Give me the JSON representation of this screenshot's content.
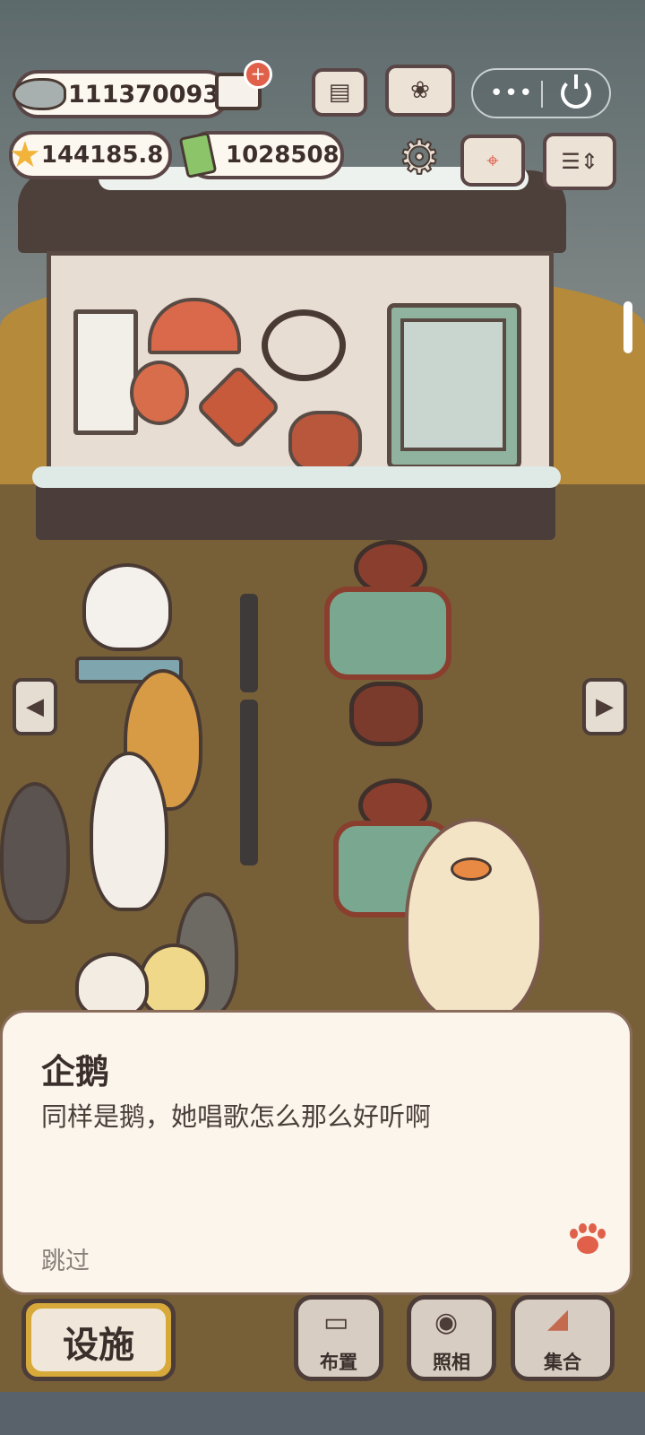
{
  "hud": {
    "fish_currency": "111370093",
    "star_currency": "144185.8",
    "ticket_currency": "1028508"
  },
  "dialog": {
    "speaker": "企鹅",
    "text": "同样是鹅，她唱歌怎么那么好听啊",
    "skip_label": "跳过"
  },
  "bottom_bar": {
    "facilities_label": "设施",
    "arrange_label": "布置",
    "photo_label": "照相",
    "gather_label": "集合"
  },
  "colors": {
    "accent": "#e0604a",
    "panel_bg": "#fbf5ec",
    "outline": "#5a4646",
    "facilities_gold": "#d7a93a"
  },
  "icons": [
    "fish-icon",
    "cart-plus-icon",
    "newspaper-icon",
    "paw-book-icon",
    "more-dots-icon",
    "power-icon",
    "star-icon",
    "ticket-icon",
    "gear-icon",
    "map-icon",
    "sort-icon",
    "arrow-left-icon",
    "arrow-right-icon",
    "paw-icon",
    "roller-icon",
    "camera-icon",
    "whistle-icon"
  ]
}
